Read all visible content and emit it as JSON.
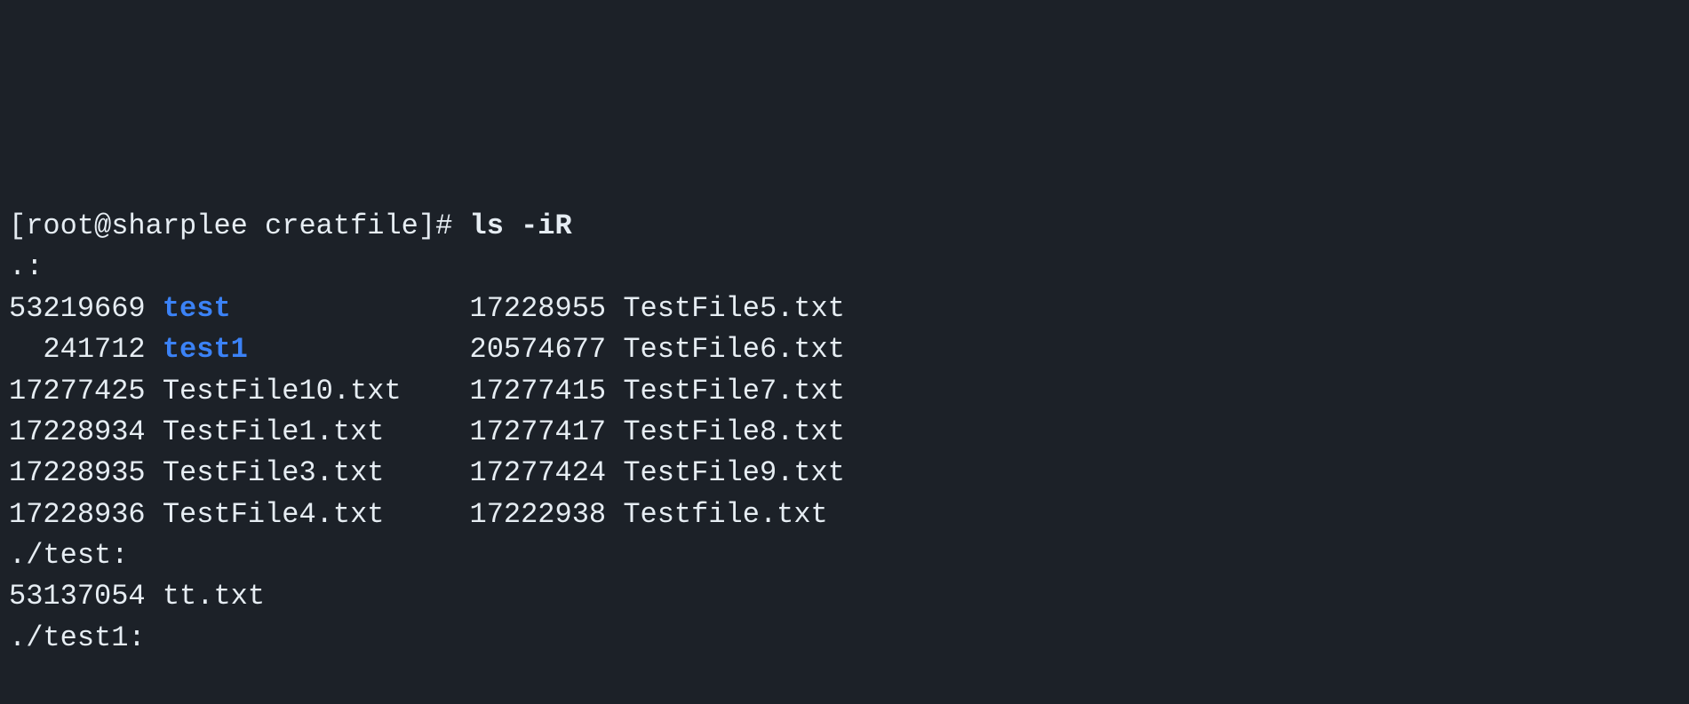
{
  "prompt": {
    "user": "root",
    "host": "sharplee",
    "cwd": "creatfile",
    "symbol": "#",
    "command": "ls -iR"
  },
  "sections": [
    {
      "header": ".:",
      "columns": 2,
      "entries": [
        {
          "inode": "53219669",
          "name": "test",
          "is_dir": true
        },
        {
          "inode": "17228955",
          "name": "TestFile5.txt",
          "is_dir": false
        },
        {
          "inode": "  241712",
          "name": "test1",
          "is_dir": true
        },
        {
          "inode": "20574677",
          "name": "TestFile6.txt",
          "is_dir": false
        },
        {
          "inode": "17277425",
          "name": "TestFile10.txt",
          "is_dir": false
        },
        {
          "inode": "17277415",
          "name": "TestFile7.txt",
          "is_dir": false
        },
        {
          "inode": "17228934",
          "name": "TestFile1.txt",
          "is_dir": false
        },
        {
          "inode": "17277417",
          "name": "TestFile8.txt",
          "is_dir": false
        },
        {
          "inode": "17228935",
          "name": "TestFile3.txt",
          "is_dir": false
        },
        {
          "inode": "17277424",
          "name": "TestFile9.txt",
          "is_dir": false
        },
        {
          "inode": "17228936",
          "name": "TestFile4.txt",
          "is_dir": false
        },
        {
          "inode": "17222938",
          "name": "Testfile.txt",
          "is_dir": false
        }
      ]
    },
    {
      "header": "./test:",
      "columns": 1,
      "entries": [
        {
          "inode": "53137054",
          "name": "tt.txt",
          "is_dir": false
        }
      ]
    },
    {
      "header": "./test1:",
      "columns": 1,
      "entries": []
    }
  ],
  "layout": {
    "col1_inode_w": 8,
    "col1_name_w": 16,
    "gap": "  "
  }
}
